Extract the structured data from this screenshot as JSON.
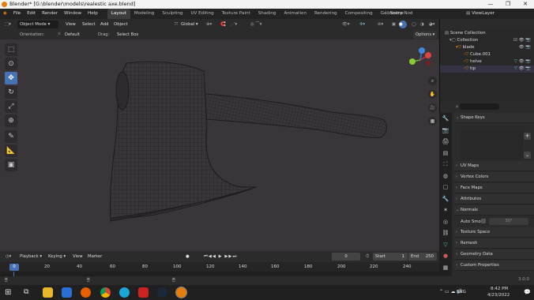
{
  "window": {
    "title": "Blender* [G:\\blender\\models\\realestic axe.blend]",
    "controls": [
      "—",
      "❐",
      "✕"
    ]
  },
  "menu": {
    "items": [
      "File",
      "Edit",
      "Render",
      "Window",
      "Help"
    ],
    "workspaces": [
      "Layout",
      "Modeling",
      "Sculpting",
      "UV Editing",
      "Texture Paint",
      "Shading",
      "Animation",
      "Rendering",
      "Compositing",
      "Geometry Nod"
    ],
    "scene_label": "Scene",
    "viewlayer_label": "ViewLayer"
  },
  "header": {
    "mode": "Object Mode",
    "menus": [
      "View",
      "Select",
      "Add",
      "Object"
    ],
    "transform": "Global"
  },
  "toolsettings": {
    "orientation_label": "Orientation:",
    "orientation_value": "Default",
    "drag_label": "Drag:",
    "drag_value": "Select Box",
    "options_label": "Options"
  },
  "outliner": {
    "items": [
      {
        "label": "Scene Collection",
        "depth": 0
      },
      {
        "label": "Collection",
        "depth": 1
      },
      {
        "label": "blade",
        "depth": 2
      },
      {
        "label": "Cube.001",
        "depth": 3
      },
      {
        "label": "helve",
        "depth": 3
      },
      {
        "label": "tip",
        "depth": 3
      }
    ]
  },
  "properties": {
    "panels": [
      "Shape Keys",
      "UV Maps",
      "Vertex Colors",
      "Face Maps",
      "Attributes",
      "Normals",
      "Texture Space",
      "Remesh",
      "Geometry Data",
      "Custom Properties"
    ],
    "auto_smooth_label": "Auto Smo...",
    "auto_smooth_value": "30°"
  },
  "timeline": {
    "menus": [
      "Playback",
      "Keying",
      "View",
      "Marker"
    ],
    "current_frame": "0",
    "start_label": "Start",
    "start_value": "1",
    "end_label": "End",
    "end_value": "250",
    "ruler": [
      "0",
      "20",
      "40",
      "60",
      "80",
      "100",
      "120",
      "140",
      "160",
      "180",
      "200",
      "220",
      "240"
    ]
  },
  "status": {
    "version": "3.0.0"
  },
  "taskbar": {
    "time": "8:42 PM",
    "date": "4/23/2022",
    "language": "ENG"
  },
  "colors": {
    "accent": "#4772b3",
    "viewport": "#3a3539",
    "orange": "#e87d0d"
  }
}
